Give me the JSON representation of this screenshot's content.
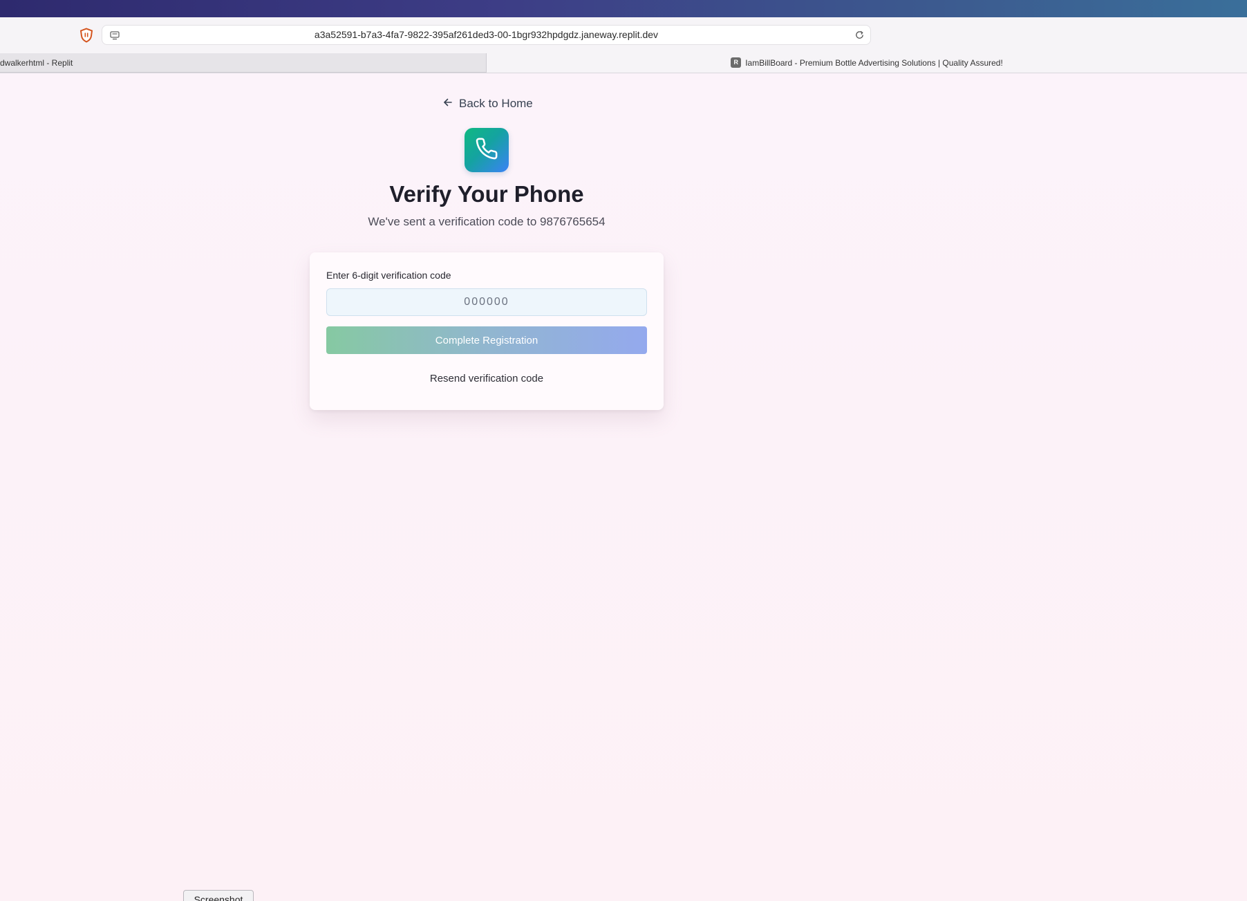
{
  "browser": {
    "url": "a3a52591-b7a3-4fa7-9822-395af261ded3-00-1bgr932hpdgdz.janeway.replit.dev",
    "tabs": [
      {
        "label": "dwalkerhtml - Replit",
        "active": false
      },
      {
        "label": "IamBillBoard - Premium Bottle Advertising Solutions | Quality Assured!",
        "active": true,
        "favicon": "R"
      }
    ],
    "icons": {
      "shield": "shield-icon",
      "site": "site-settings-icon",
      "reload": "reload-icon"
    }
  },
  "page": {
    "back_link": "Back to Home",
    "title": "Verify Your Phone",
    "subtitle": "We've sent a verification code to 9876765654",
    "badge_icon": "phone-icon",
    "accent_gradient": [
      "#10b981",
      "#3b82f6"
    ]
  },
  "form": {
    "label": "Enter 6-digit verification code",
    "code_placeholder": "000000",
    "code_value": "",
    "submit_label": "Complete Registration",
    "resend_label": "Resend verification code"
  },
  "footer": {
    "screenshot_label": "Screenshot"
  }
}
